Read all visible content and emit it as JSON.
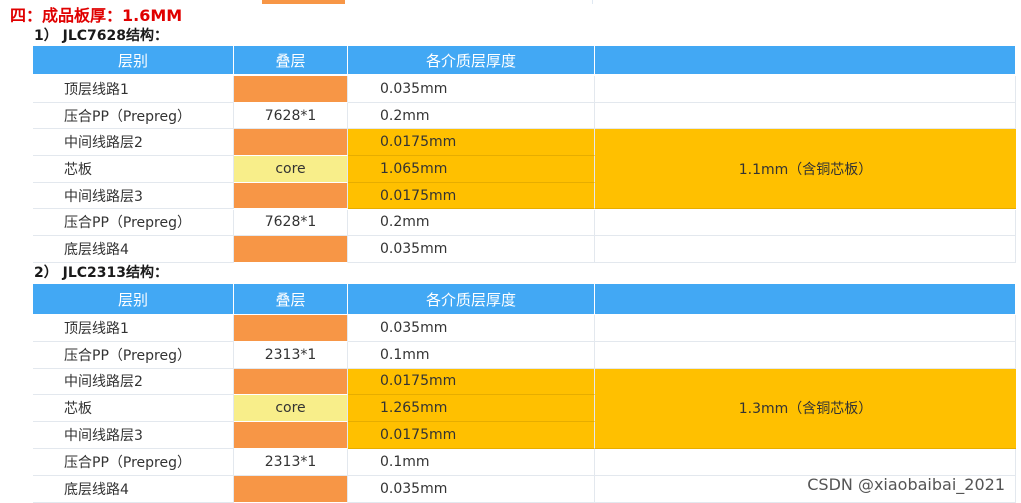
{
  "section_title": "四：成品板厚：1.6MM",
  "tables": [
    {
      "subtitle": "1） JLC7628结构：",
      "headers": [
        "层别",
        "叠层",
        "各介质层厚度",
        ""
      ],
      "rows": [
        {
          "layer": "顶层线路1",
          "stack": "",
          "thickness": "0.035mm"
        },
        {
          "layer": "压合PP（Prepreg）",
          "stack": "7628*1",
          "thickness": "0.2mm"
        },
        {
          "layer": "中间线路层2",
          "stack": "",
          "thickness": "0.0175mm"
        },
        {
          "layer": "芯板",
          "stack": "core",
          "thickness": "1.065mm"
        },
        {
          "layer": "中间线路层3",
          "stack": "",
          "thickness": "0.0175mm"
        },
        {
          "layer": "压合PP（Prepreg）",
          "stack": "7628*1",
          "thickness": "0.2mm"
        },
        {
          "layer": "底层线路4",
          "stack": "",
          "thickness": "0.035mm"
        }
      ],
      "combined_note": "1.1mm（含铜芯板）"
    },
    {
      "subtitle": "2） JLC2313结构：",
      "headers": [
        "层别",
        "叠层",
        "各介质层厚度",
        ""
      ],
      "rows": [
        {
          "layer": "顶层线路1",
          "stack": "",
          "thickness": "0.035mm"
        },
        {
          "layer": "压合PP（Prepreg）",
          "stack": "2313*1",
          "thickness": "0.1mm"
        },
        {
          "layer": "中间线路层2",
          "stack": "",
          "thickness": "0.0175mm"
        },
        {
          "layer": "芯板",
          "stack": "core",
          "thickness": "1.265mm"
        },
        {
          "layer": "中间线路层3",
          "stack": "",
          "thickness": "0.0175mm"
        },
        {
          "layer": "压合PP（Prepreg）",
          "stack": "2313*1",
          "thickness": "0.1mm"
        },
        {
          "layer": "底层线路4",
          "stack": "",
          "thickness": "0.035mm"
        }
      ],
      "combined_note": "1.3mm（含铜芯板）"
    }
  ],
  "watermark": "CSDN @xiaobaibai_2021",
  "colors": {
    "header_bg": "#42a8f4",
    "copper_layer": "#f79646",
    "core_layer": "#f8ee8a",
    "inner_highlight": "#ffc000",
    "title_red": "#e00000"
  }
}
